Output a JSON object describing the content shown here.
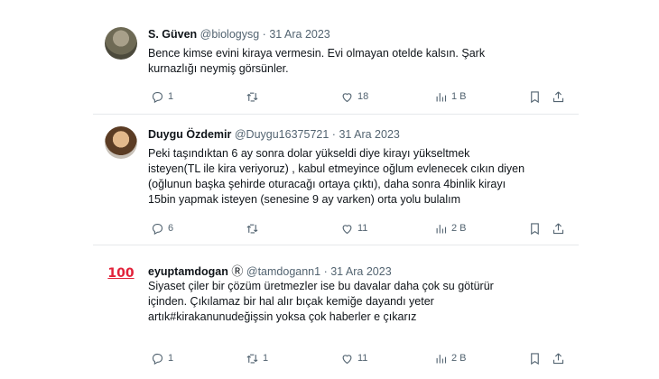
{
  "tweets": [
    {
      "name": "S. Güven",
      "handle": "@biologysg",
      "separator": "·",
      "date": "31 Ara 2023",
      "text_lines": [
        "Bence kimse evini kiraya vermesin. Evi olmayan otelde kalsın. Şark",
        "kurnazlığı neymiş görsünler."
      ],
      "replies": "1",
      "retweets": "",
      "likes": "18",
      "views": "1 B"
    },
    {
      "name": "Duygu Özdemir",
      "handle": "@Duygu16375721",
      "separator": "·",
      "date": "31 Ara 2023",
      "text_lines": [
        "Peki taşındıktan 6 ay sonra dolar yükseldi diye kirayı yükseltmek",
        "isteyen(TL ile kira veriyoruz) , kabul etmeyince oğlum evlenecek cıkın diyen",
        "(oğlunun başka şehirde oturacağı ortaya çıktı), daha sonra 4binlik kirayı",
        "15bin yapmak isteyen (senesine 9 ay varken) orta yolu bulalım"
      ],
      "replies": "6",
      "retweets": "",
      "likes": "11",
      "views": "2 B"
    },
    {
      "name": "eyuptamdogan",
      "badge": "Ⓡ",
      "handle": "@tamdogann1",
      "separator": "·",
      "date": "31 Ara 2023",
      "avatar_text": "100",
      "text_lines": [
        "Siyaset çiler bir çözüm üretmezler ise bu davalar daha çok su götürür",
        "içinden. Çıkılamaz bir hal alır bıçak kemiğe dayandı yeter",
        "artık#kirakanunudeğişsin yoksa çok haberler e çıkarız"
      ],
      "replies": "1",
      "retweets": "1",
      "likes": "11",
      "views": "2 B"
    }
  ],
  "icons": {
    "reply": "reply-icon",
    "retweet": "retweet-icon",
    "like": "heart-icon",
    "views": "views-icon",
    "bookmark": "bookmark-icon",
    "share": "share-icon"
  }
}
